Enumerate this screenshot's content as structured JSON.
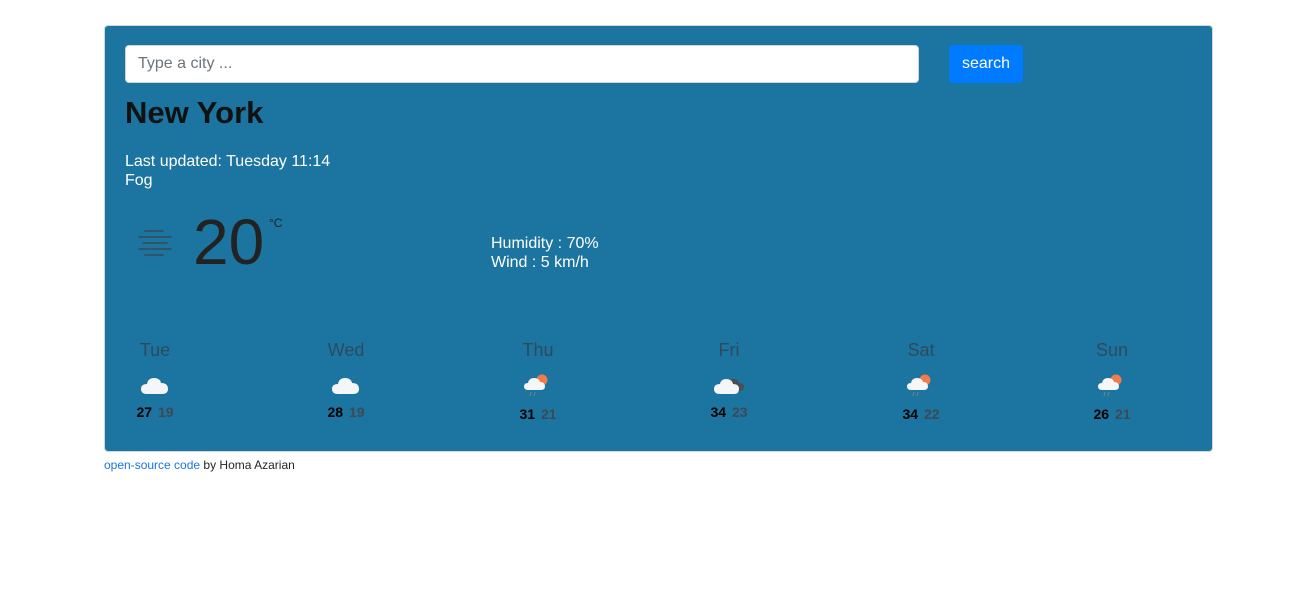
{
  "search": {
    "placeholder": "Type a city ...",
    "value": "",
    "button_label": "search"
  },
  "current": {
    "city": "New York",
    "last_updated": "Last updated: Tuesday 11:14",
    "condition": "Fog",
    "temperature": "20",
    "unit": "°C",
    "icon": "fog-icon",
    "humidity": "Humidity : 70%",
    "wind": "Wind : 5 km/h"
  },
  "forecast": [
    {
      "day": "Tue",
      "icon": "cloud-icon",
      "max": "27",
      "min": "19"
    },
    {
      "day": "Wed",
      "icon": "cloud-icon",
      "max": "28",
      "min": "19"
    },
    {
      "day": "Thu",
      "icon": "sun-cloud-rain-icon",
      "max": "31",
      "min": "21"
    },
    {
      "day": "Fri",
      "icon": "cloud-dark-cloud-icon",
      "max": "34",
      "min": "23"
    },
    {
      "day": "Sat",
      "icon": "sun-cloud-rain-icon",
      "max": "34",
      "min": "22"
    },
    {
      "day": "Sun",
      "icon": "sun-cloud-rain-icon",
      "max": "26",
      "min": "21"
    }
  ],
  "footer": {
    "link_text": "open-source code",
    "suffix": " by Homa Azarian"
  },
  "colors": {
    "card_bg": "#1c74a0",
    "button": "#007bff",
    "link": "#1a73e8"
  }
}
